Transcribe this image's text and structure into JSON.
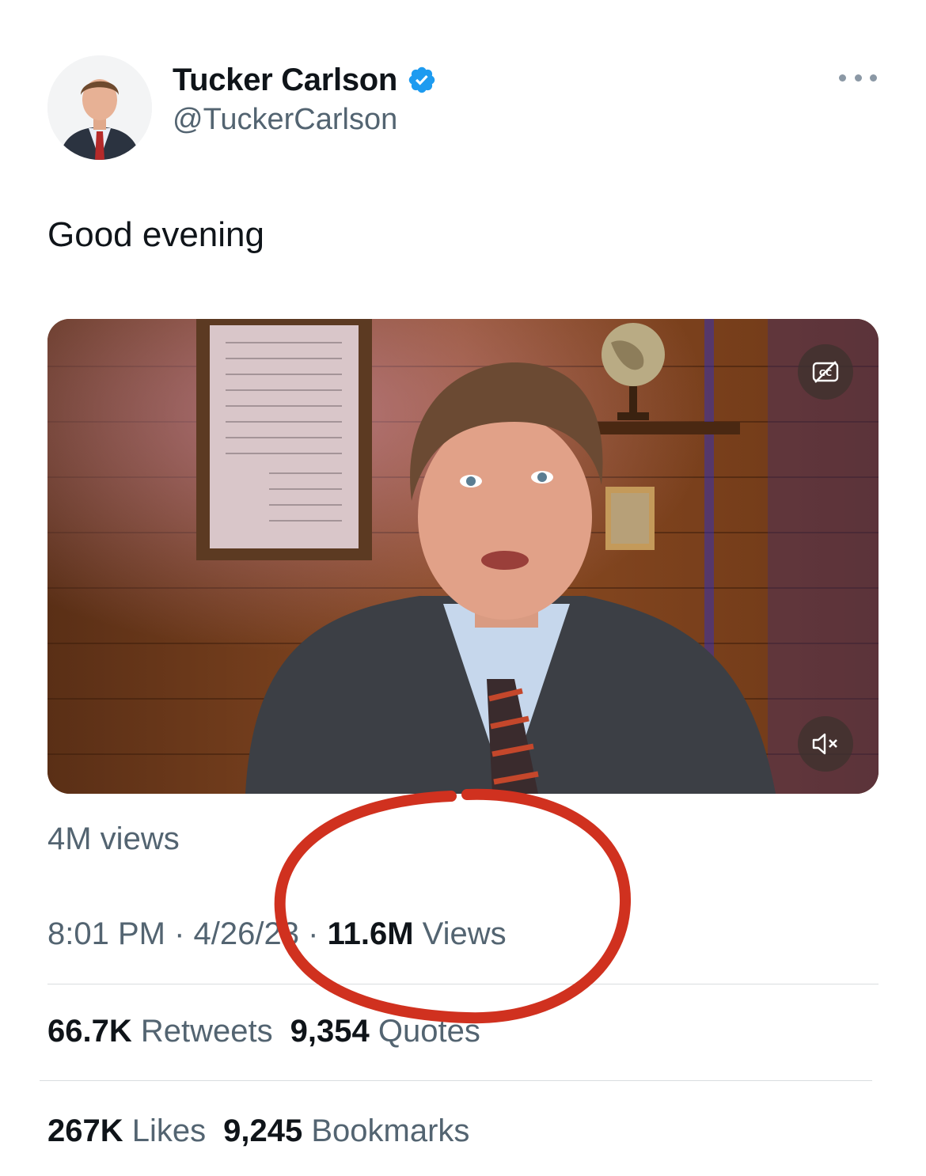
{
  "author": {
    "name": "Tucker Carlson",
    "handle": "@TuckerCarlson",
    "verified": true,
    "avatar_icon": "profile-photo"
  },
  "tweet": {
    "text": "Good evening"
  },
  "media": {
    "type": "video",
    "cc_icon": "captions-off-icon",
    "mute_icon": "muted-speaker-icon"
  },
  "video_views": "4M views",
  "meta": {
    "time": "8:01 PM",
    "date": "4/26/23",
    "views_count": "11.6M",
    "views_label": "Views"
  },
  "stats": {
    "retweets_count": "66.7K",
    "retweets_label": "Retweets",
    "quotes_count": "9,354",
    "quotes_label": "Quotes",
    "likes_count": "267K",
    "likes_label": "Likes",
    "bookmarks_count": "9,245",
    "bookmarks_label": "Bookmarks"
  },
  "colors": {
    "verified_blue": "#1d9bf0",
    "secondary_text": "#536471",
    "annotation_red": "#d0311f"
  }
}
